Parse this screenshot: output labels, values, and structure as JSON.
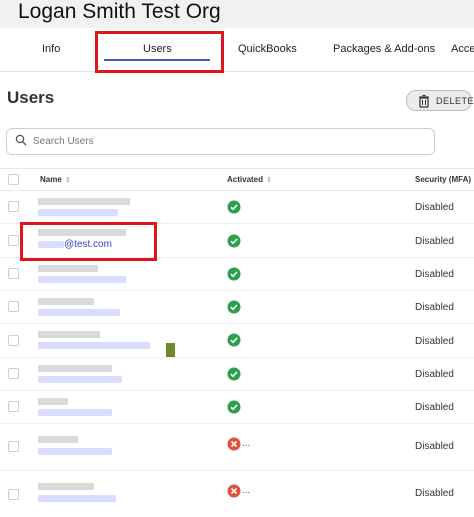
{
  "org": {
    "title": "Logan Smith Test Org"
  },
  "tabs": [
    {
      "label": "Info"
    },
    {
      "label": "Users"
    },
    {
      "label": "QuickBooks"
    },
    {
      "label": "Packages & Add-ons"
    },
    {
      "label": "Acce"
    }
  ],
  "page": {
    "title": "Users"
  },
  "toolbar": {
    "delete_label": "DELETE",
    "delete_icon": "trash-icon"
  },
  "search": {
    "placeholder": "Search Users",
    "value": ""
  },
  "table": {
    "columns": [
      "Name",
      "Activated",
      "Security (MFA)"
    ],
    "rows": [
      {
        "email": "",
        "activated": true,
        "mfa": "Disabled"
      },
      {
        "email": "@test.com",
        "activated": true,
        "mfa": "Disabled"
      },
      {
        "email": "",
        "activated": true,
        "mfa": "Disabled"
      },
      {
        "email": "",
        "activated": true,
        "mfa": "Disabled"
      },
      {
        "email": "",
        "activated": true,
        "mfa": "Disabled"
      },
      {
        "email": "",
        "activated": true,
        "mfa": "Disabled"
      },
      {
        "email": "",
        "activated": true,
        "mfa": "Disabled"
      },
      {
        "email": "",
        "activated": false,
        "status_text": "...",
        "mfa": "Disabled"
      },
      {
        "email": "",
        "activated": false,
        "status_text": "...",
        "mfa": "Disabled"
      }
    ]
  },
  "colors": {
    "accent": "#4a56c8",
    "success": "#2e9e4f",
    "error": "#e0523e",
    "highlight": "#e0151b"
  }
}
